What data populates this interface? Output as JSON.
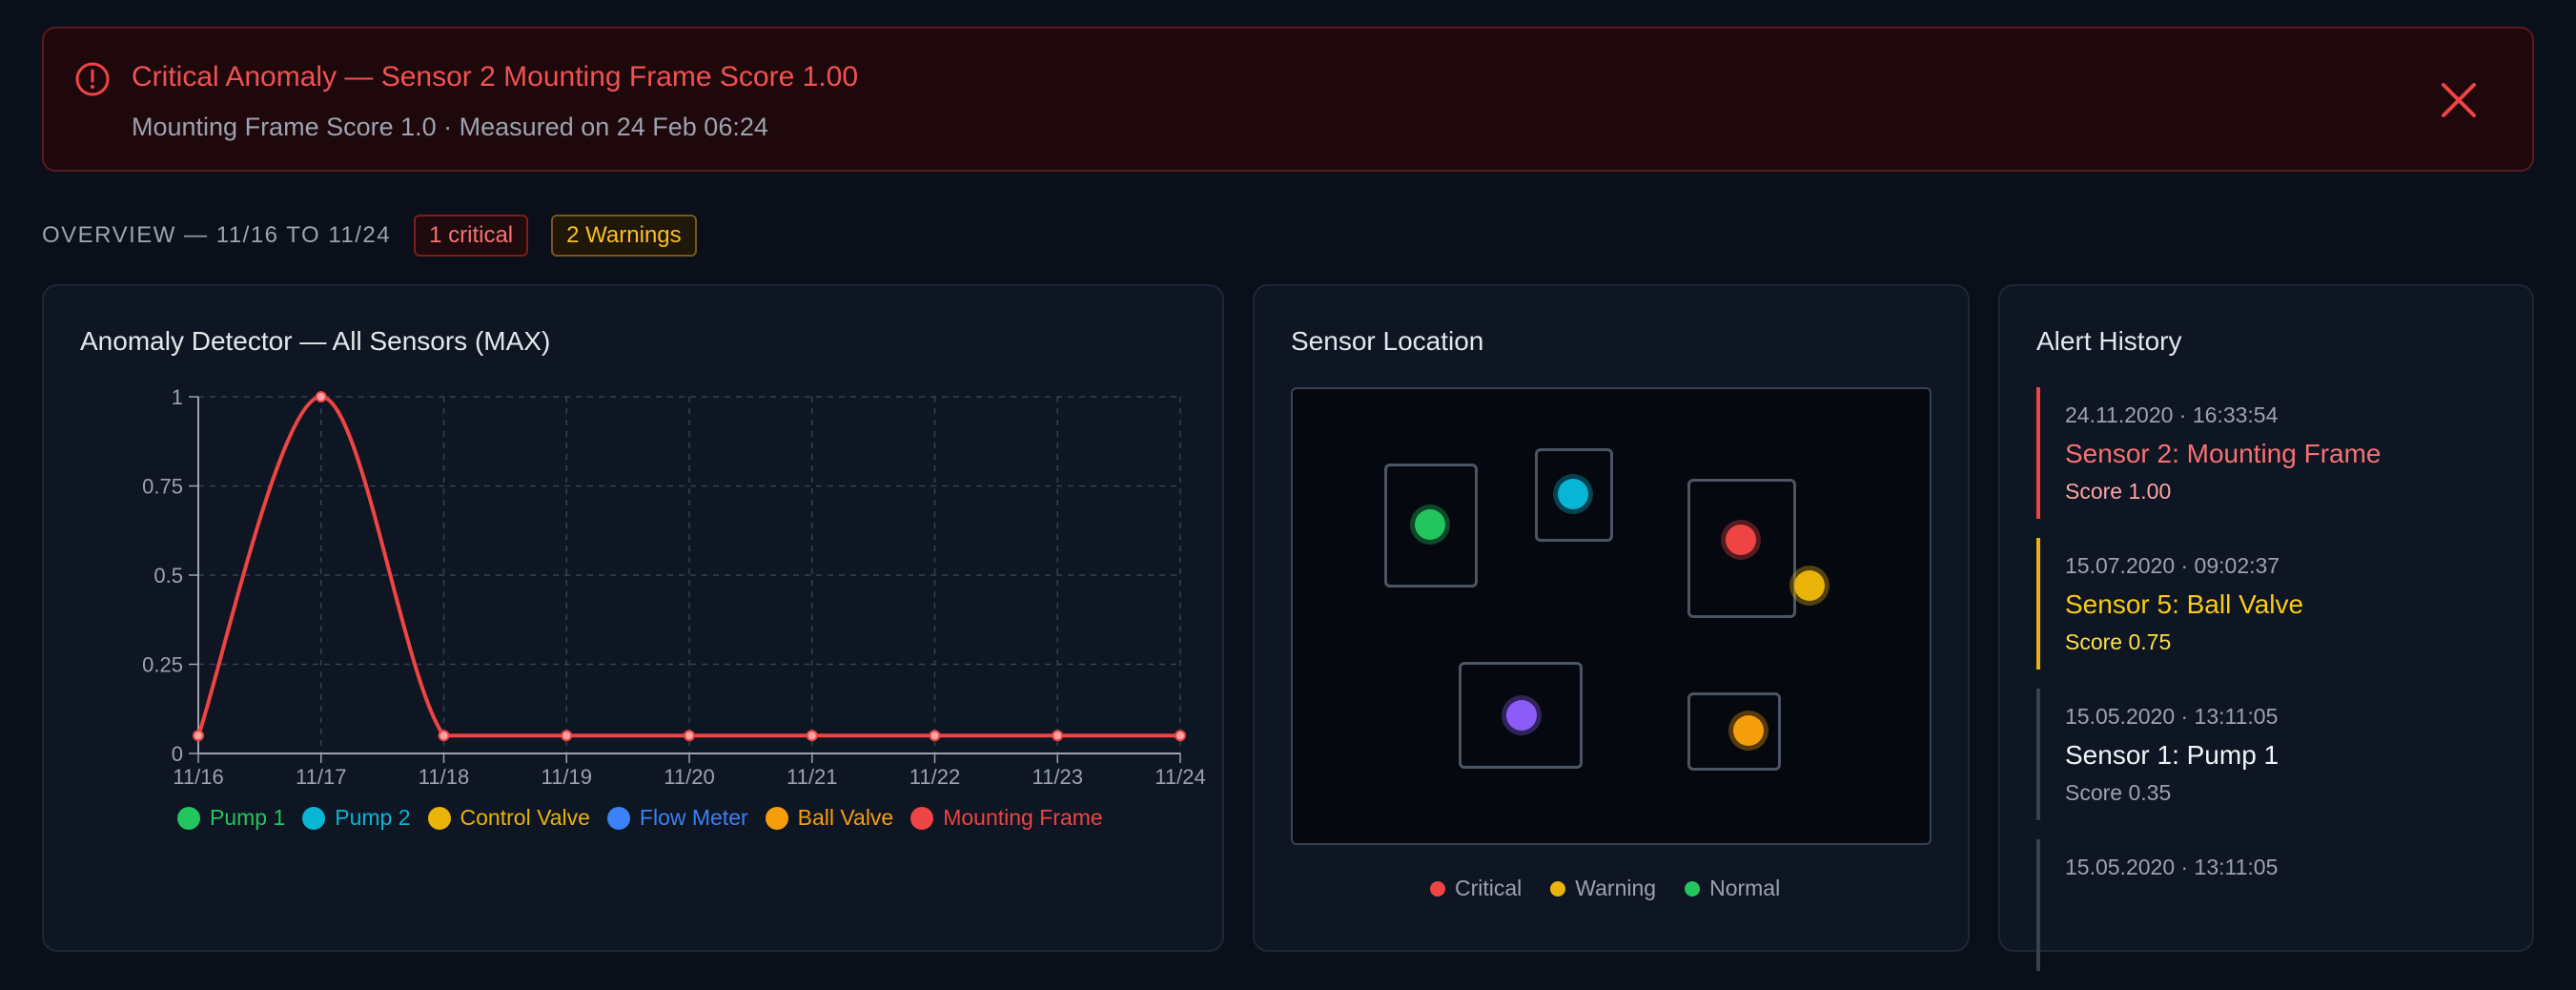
{
  "colors": {
    "critical": "#ef4444",
    "warning": "#eab308",
    "normal": "#22c55e",
    "pump1": "#22c55e",
    "pump2": "#06b6d4",
    "control_valve": "#eab308",
    "flow_meter": "#3b82f6",
    "ball_valve": "#f59e0b",
    "mounting_frame": "#ef4444",
    "purple": "#8b5cf6"
  },
  "banner": {
    "icon": "alert-circle-icon",
    "title": "Critical Anomaly — Sensor 2 Mounting Frame Score 1.00",
    "subtitle": "Mounting Frame Score 1.0 · Measured on 24 Feb 06:24",
    "close_icon": "close-icon"
  },
  "overview": {
    "label": "OVERVIEW — 11/16 TO 11/24",
    "critical_badge": "1 critical",
    "warning_badge": "2 Warnings"
  },
  "chart_card": {
    "title": "Anomaly Detector — All Sensors (MAX)"
  },
  "chart_data": {
    "type": "line",
    "title": "Anomaly Detector — All Sensors (MAX)",
    "x": [
      "11/16",
      "11/17",
      "11/18",
      "11/19",
      "11/20",
      "11/21",
      "11/22",
      "11/23",
      "11/24"
    ],
    "y_ticks": [
      "0",
      "0.25",
      "0.5",
      "0.75",
      "1"
    ],
    "ylim": [
      0,
      1
    ],
    "grid": true,
    "legend_position": "bottom",
    "series": [
      {
        "name": "Mounting Frame",
        "values": [
          0.05,
          1.0,
          0.05,
          0.05,
          0.05,
          0.05,
          0.05,
          0.05,
          0.05
        ]
      }
    ],
    "legend": [
      "Pump 1",
      "Pump 2",
      "Control Valve",
      "Flow Meter",
      "Ball Valve",
      "Mounting Frame"
    ]
  },
  "map_card": {
    "title": "Sensor Location",
    "legend": {
      "critical": "Critical",
      "warning": "Warning",
      "normal": "Normal"
    }
  },
  "history": {
    "title": "Alert History",
    "items": [
      {
        "timestamp": "24.11.2020 · 16:33:54",
        "name": "Sensor 2: Mounting Frame",
        "score": "Score 1.00",
        "level": "critical"
      },
      {
        "timestamp": "15.07.2020 · 09:02:37",
        "name": "Sensor 5: Ball Valve",
        "score": "Score 0.75",
        "level": "warning"
      },
      {
        "timestamp": "15.05.2020 · 13:11:05",
        "name": "Sensor 1: Pump 1",
        "score": "Score 0.35",
        "level": "normal"
      },
      {
        "timestamp": "15.05.2020 · 13:11:05",
        "name": "",
        "score": "",
        "level": "normal"
      }
    ]
  }
}
